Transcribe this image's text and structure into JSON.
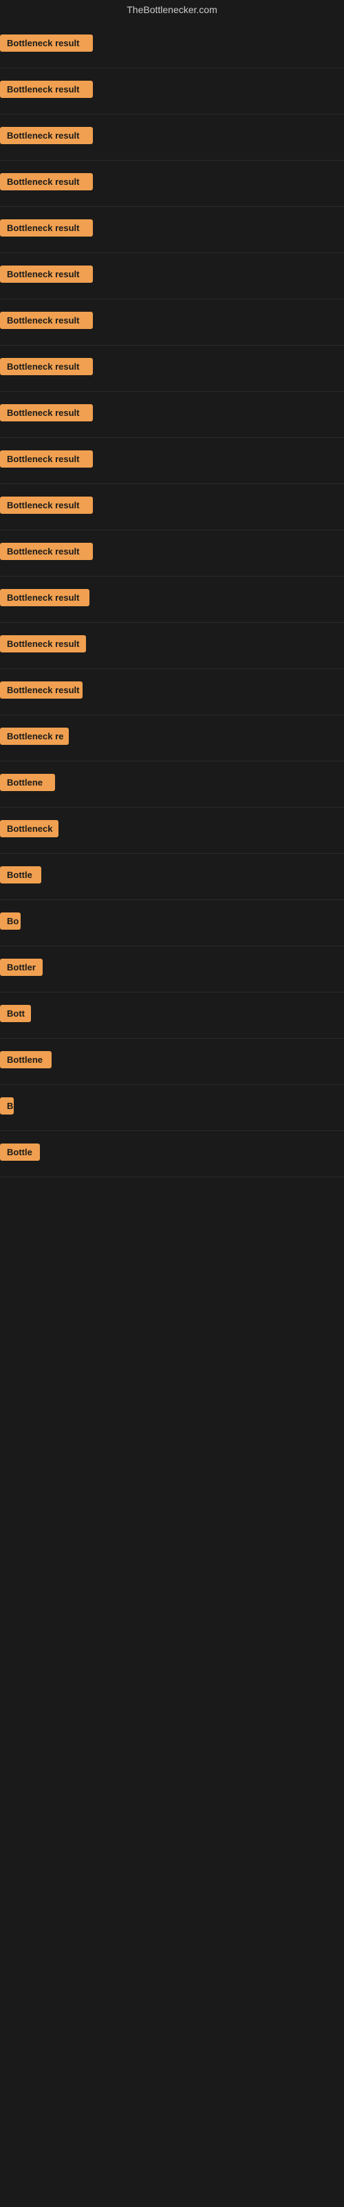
{
  "site": {
    "title": "TheBottlenecker.com"
  },
  "rows": [
    {
      "label": "Bottleneck result",
      "width": 135
    },
    {
      "label": "Bottleneck result",
      "width": 135
    },
    {
      "label": "Bottleneck result",
      "width": 135
    },
    {
      "label": "Bottleneck result",
      "width": 135
    },
    {
      "label": "Bottleneck result",
      "width": 135
    },
    {
      "label": "Bottleneck result",
      "width": 135
    },
    {
      "label": "Bottleneck result",
      "width": 135
    },
    {
      "label": "Bottleneck result",
      "width": 135
    },
    {
      "label": "Bottleneck result",
      "width": 135
    },
    {
      "label": "Bottleneck result",
      "width": 135
    },
    {
      "label": "Bottleneck result",
      "width": 135
    },
    {
      "label": "Bottleneck result",
      "width": 135
    },
    {
      "label": "Bottleneck result",
      "width": 130
    },
    {
      "label": "Bottleneck result",
      "width": 125
    },
    {
      "label": "Bottleneck result",
      "width": 120
    },
    {
      "label": "Bottleneck re",
      "width": 100
    },
    {
      "label": "Bottlene",
      "width": 80
    },
    {
      "label": "Bottleneck",
      "width": 85
    },
    {
      "label": "Bottle",
      "width": 60
    },
    {
      "label": "Bo",
      "width": 30
    },
    {
      "label": "Bottler",
      "width": 62
    },
    {
      "label": "Bott",
      "width": 45
    },
    {
      "label": "Bottlene",
      "width": 75
    },
    {
      "label": "B",
      "width": 20
    },
    {
      "label": "Bottle",
      "width": 58
    }
  ]
}
